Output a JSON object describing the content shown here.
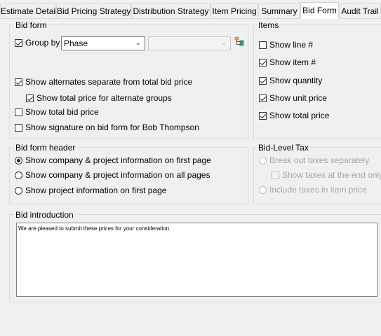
{
  "tabs": [
    {
      "label": "Estimate Detail"
    },
    {
      "label": "Bid Pricing Strategy"
    },
    {
      "label": "Distribution Strategy"
    },
    {
      "label": "Item Pricing"
    },
    {
      "label": "Summary"
    },
    {
      "label": "Bid Form",
      "active": true
    },
    {
      "label": "Audit Trail"
    }
  ],
  "bid_form": {
    "title": "Bid form",
    "group_by_label": "Group by",
    "group_by_checked": true,
    "group_by_value": "Phase",
    "secondary_select_value": "",
    "options": [
      {
        "label": "Show alternates separate from total bid price",
        "checked": true
      },
      {
        "label": "Show total price for alternate groups",
        "checked": true
      },
      {
        "label": "Show total bid price",
        "checked": false
      },
      {
        "label": "Show signature on bid form for Bob Thompson",
        "checked": false
      }
    ]
  },
  "items": {
    "title": "Items",
    "options": [
      {
        "label": "Show line #",
        "checked": false
      },
      {
        "label": "Show item #",
        "checked": true
      },
      {
        "label": "Show quantity",
        "checked": true
      },
      {
        "label": "Show unit price",
        "checked": true
      },
      {
        "label": "Show total price",
        "checked": true
      }
    ]
  },
  "bid_form_header": {
    "title": "Bid form header",
    "options": [
      {
        "label": "Show company & project information on first page",
        "selected": true
      },
      {
        "label": "Show company & project information on all pages",
        "selected": false
      },
      {
        "label": "Show project information on first page",
        "selected": false
      }
    ]
  },
  "bid_level_tax": {
    "title": "Bid-Level Tax",
    "break_out_label": "Break out taxes separately",
    "show_taxes_end_label": "Show taxes at the end only",
    "include_taxes_label": "Include taxes in item price"
  },
  "bid_introduction": {
    "title": "Bid introduction",
    "text": "We are pleased to submit these prices for your consideration."
  }
}
